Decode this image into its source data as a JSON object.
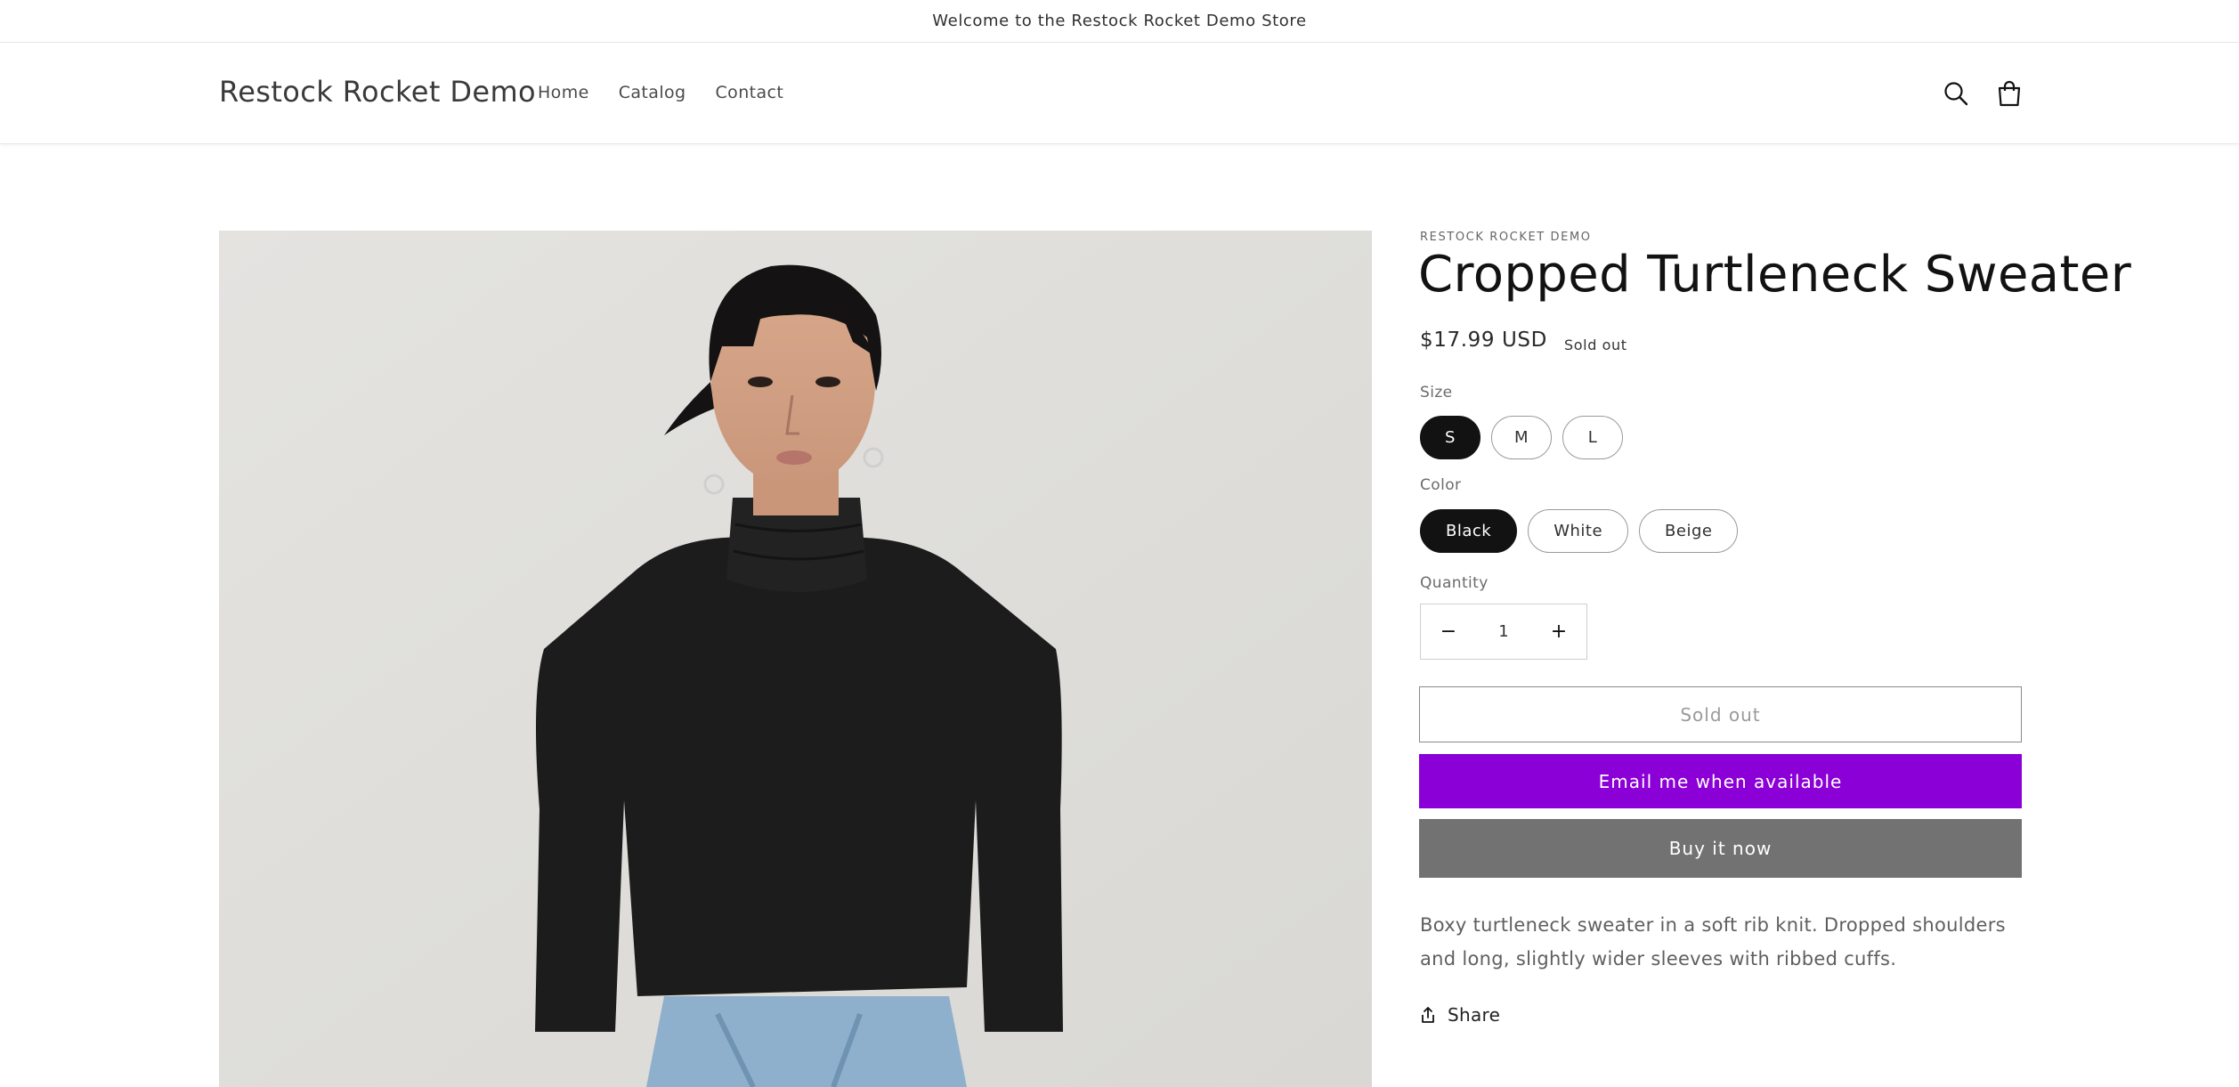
{
  "announcement": {
    "text": "Welcome to the Restock Rocket Demo Store"
  },
  "header": {
    "logo": "Restock Rocket Demo",
    "nav": [
      {
        "label": "Home"
      },
      {
        "label": "Catalog"
      },
      {
        "label": "Contact"
      }
    ],
    "icons": [
      "search-icon",
      "cart-icon"
    ]
  },
  "product": {
    "vendor": "RESTOCK ROCKET DEMO",
    "title": "Cropped Turtleneck Sweater",
    "price": "$17.99 USD",
    "badge": "Sold out",
    "size": {
      "label": "Size",
      "options": [
        "S",
        "M",
        "L"
      ],
      "selected": "S"
    },
    "color": {
      "label": "Color",
      "options": [
        "Black",
        "White",
        "Beige"
      ],
      "selected": "Black"
    },
    "quantity": {
      "label": "Quantity",
      "value": "1",
      "minus": "−",
      "plus": "+"
    },
    "buttons": {
      "sold_out": "Sold out",
      "notify": "Email me when available",
      "buy_now": "Buy it now"
    },
    "description": "Boxy turtleneck sweater in a soft rib knit. Dropped shoulders and long, slightly wider sleeves with ribbed cuffs.",
    "share": "Share"
  },
  "colors": {
    "accent": "#8a00d6",
    "buy_now": "#727272",
    "selected_pill": "#121212"
  }
}
